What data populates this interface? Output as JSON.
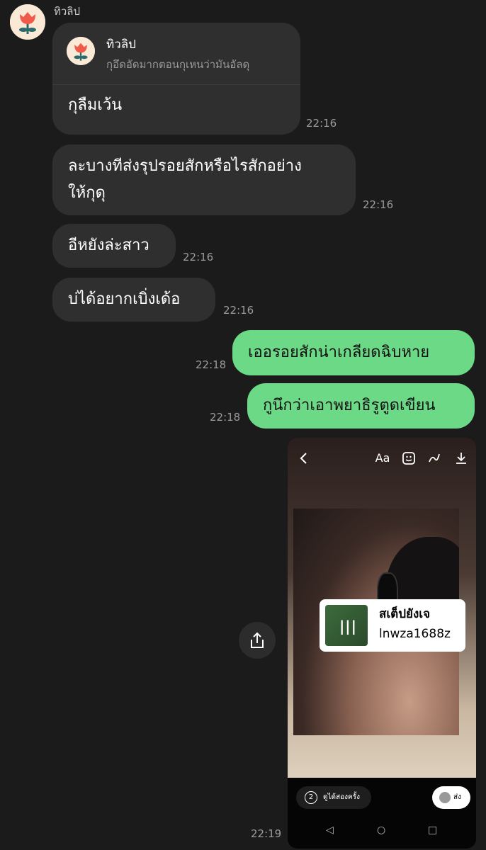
{
  "contact": {
    "name": "ทิวลิป"
  },
  "reply": {
    "name": "ทิวลิป",
    "preview": "กุอึดอัดมากตอนกุเหนว่ามันอัลดุ"
  },
  "messages": [
    {
      "text": "กุลืมเว้น",
      "time": "22:16"
    },
    {
      "line1": "ละบางทีส่งรุปรอยสักหรือไรสักอย่าง",
      "line2": "ให้กุดุ",
      "time": "22:16"
    },
    {
      "text": "อีหยังล่ะสาว",
      "time": "22:16"
    },
    {
      "text": "บ่ได้อยากเบิ่งเด้อ",
      "time": "22:16"
    },
    {
      "text": "เออรอยสักน่าเกลียดฉิบหาย",
      "time": "22:18"
    },
    {
      "text": "กูนึกว่าเอาพยาธิรูตูดเขียน",
      "time": "22:18"
    },
    {
      "time": "22:19"
    }
  ],
  "story": {
    "top_icons": {
      "text_tool": "Aa"
    },
    "music": {
      "title": "สเต็ปยังเจ",
      "artist": "lnwza1688z"
    },
    "view_once": {
      "number": "2",
      "label": "ดูได้สองครั้ง"
    },
    "send_label": "ส่ง"
  },
  "colors": {
    "incoming": "#2f2f2f",
    "outgoing": "#6cd987",
    "background": "#1b1b1b"
  }
}
